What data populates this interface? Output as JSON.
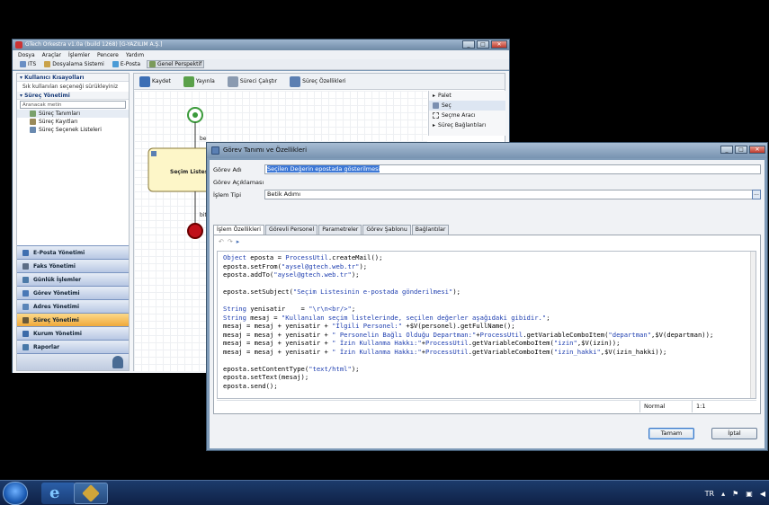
{
  "main_window": {
    "title": "GTech Orkestra v1.0a (build 1268) [G-YAZILIM A.Ş.]",
    "menu": [
      "Dosya",
      "Araçlar",
      "İşlemler",
      "Pencere",
      "Yardım"
    ],
    "toolbar": [
      "ITS",
      "Dosyalama Sistemi",
      "E-Posta",
      "Genel Perspektif"
    ],
    "left_panel": {
      "shortcuts_header": "Kullanıcı Kısayolları",
      "shortcuts_hint": "Sık kullanılan seçeneği sürükleyiniz",
      "process_header": "Süreç Yönetimi",
      "search_placeholder": "Aranacak metin",
      "tree_items": [
        "Süreç Tanımları",
        "Süreç Kayıtları",
        "Süreç Seçenek Listeleri"
      ],
      "nav": [
        "E-Posta Yönetimi",
        "Faks Yönetimi",
        "Günlük İşlemler",
        "Görev Yönetimi",
        "Adres Yönetimi",
        "Süreç Yönetimi",
        "Kurum Yönetimi",
        "Raporlar"
      ],
      "nav_active": "Süreç Yönetimi"
    },
    "editor_toolbar": [
      "Kaydet",
      "Yayınla",
      "Süreci Çalıştır",
      "Süreç Özellikleri"
    ],
    "palette": {
      "title": "Palet",
      "items": [
        "Seç",
        "Seçme Aracı"
      ],
      "section": "Süreç Bağlantıları"
    },
    "canvas": {
      "task_label": "Seçim Listesi D",
      "edge_label_1": "be",
      "edge_label_2": "bit"
    }
  },
  "dialog": {
    "title": "Görev Tanımı ve Özellikleri",
    "fields": {
      "name_label": "Görev Adı",
      "name_value": "Seçilen Değerin epostada gösterilmesi",
      "desc_label": "Görev Açıklaması",
      "desc_value": "",
      "type_label": "İşlem Tipi",
      "type_value": "Betik Adımı",
      "more_button": "..."
    },
    "tabs": [
      "İşlem Özellikleri",
      "Görevli Personel",
      "Parametreler",
      "Görev Şablonu",
      "Bağlantılar"
    ],
    "active_tab": "İşlem Özellikleri",
    "code": [
      "Object eposta = ProcessUtil.createMail();",
      "eposta.setFrom(\"aysel@gtech.web.tr\");",
      "eposta.addTo(\"aysel@gtech.web.tr\");",
      "",
      "eposta.setSubject(\"Seçim Listesinin e-postada gönderilmesi\");",
      "",
      "String yenisatir    = \"\\r\\n<br/>\";",
      "String mesaj = \"Kullanılan seçim listelerinde, seçilen değerler aşağıdaki gibidir.\";",
      "mesaj = mesaj + yenisatir + \"İlgili Personel:\" +$V(personel).getFullName();",
      "mesaj = mesaj + yenisatir + \" Personelin Bağlı Olduğu Departman:\"+ProcessUtil.getVariableComboItem(\"departman\",$V(departman));",
      "mesaj = mesaj + yenisatir + \" İzin Kullanma Hakkı:\"+ProcessUtil.getVariableComboItem(\"izin\",$V(izin));",
      "mesaj = mesaj + yenisatir + \" İzin Kullanma Hakkı:\"+ProcessUtil.getVariableComboItem(\"izin_hakki\",$V(izin_hakki));",
      "",
      "eposta.setContentType(\"text/html\");",
      "eposta.setText(mesaj);",
      "eposta.send();"
    ],
    "status": {
      "mode": "Normal",
      "position": "1:1"
    },
    "buttons": {
      "ok": "Tamam",
      "cancel": "İptal"
    }
  },
  "taskbar": {
    "language": "TR"
  },
  "colors": {
    "accent": "#3d78d6",
    "nav_active": "#f0a93a",
    "keyword": "#1f3fb0",
    "string": "#1f3fb0"
  }
}
